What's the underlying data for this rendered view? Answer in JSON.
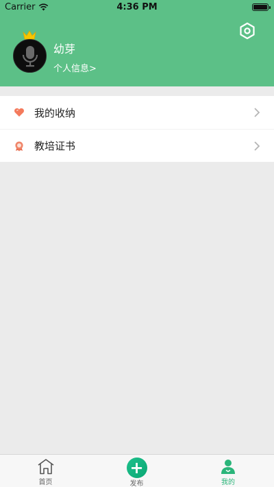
{
  "status_bar": {
    "carrier": "Carrier",
    "time": "4:36 PM"
  },
  "profile": {
    "name": "幼芽",
    "link_label": "个人信息>"
  },
  "menu": {
    "items": [
      {
        "label": "我的收纳",
        "icon": "heart-icon"
      },
      {
        "label": "教培证书",
        "icon": "certificate-badge-icon"
      }
    ]
  },
  "tabbar": {
    "tabs": [
      {
        "label": "首页",
        "icon": "home-icon",
        "active": false
      },
      {
        "label": "发布",
        "icon": "plus-circle-icon",
        "active": false
      },
      {
        "label": "我的",
        "icon": "user-icon",
        "active": true
      }
    ]
  },
  "colors": {
    "header": "#5cc087",
    "accent": "#2bb57a",
    "background": "#ebebeb"
  }
}
